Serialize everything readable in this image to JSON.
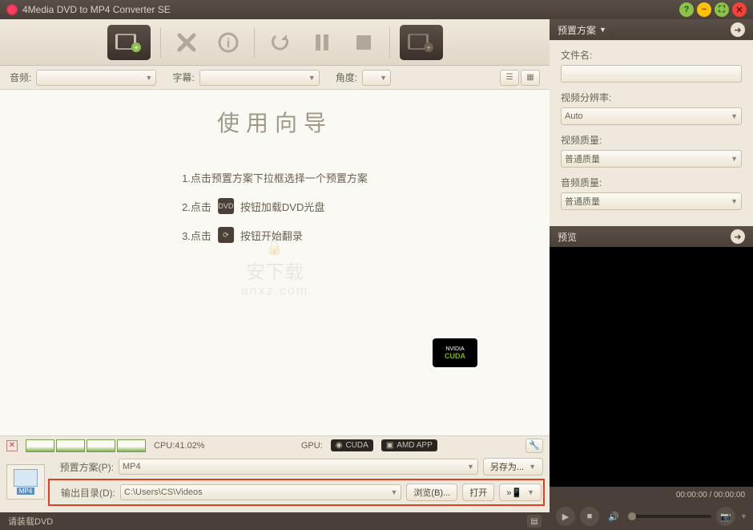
{
  "title": "4Media DVD to MP4 Converter SE",
  "filters": {
    "audio_label": "音频:",
    "audio_value": "",
    "subtitle_label": "字幕:",
    "subtitle_value": "",
    "angle_label": "角度:",
    "angle_value": ""
  },
  "wizard": {
    "heading": "使用向导",
    "step1": "1.点击预置方案下拉框选择一个预置方案",
    "step2_pre": "2.点击",
    "step2_post": "按钮加载DVD光盘",
    "step3_pre": "3.点击",
    "step3_post": "按钮开始翻录"
  },
  "watermark": {
    "top": "安下载",
    "bottom": "anxz.com"
  },
  "cuda": {
    "brand": "NVIDIA",
    "tech": "CUDA"
  },
  "status": {
    "cpu_label": "CPU:41.02%",
    "gpu_label": "GPU:",
    "cuda": "CUDA",
    "amd": "AMD APP"
  },
  "profile": {
    "label": "预置方案(P):",
    "value": "MP4",
    "saveas": "另存为..."
  },
  "output": {
    "label": "输出目录(D):",
    "value": "C:\\Users\\CS\\Videos",
    "browse": "浏览(B)...",
    "open": "打开"
  },
  "footer": {
    "status": "请装载DVD"
  },
  "right": {
    "preset_header": "预置方案",
    "filename_label": "文件名:",
    "filename_value": "",
    "resolution_label": "视频分辨率:",
    "resolution_value": "Auto",
    "vquality_label": "视频质量:",
    "vquality_value": "普通质量",
    "aquality_label": "音频质量:",
    "aquality_value": "普通质量",
    "preview_header": "预览",
    "time": "00:00:00 / 00:00:00"
  }
}
